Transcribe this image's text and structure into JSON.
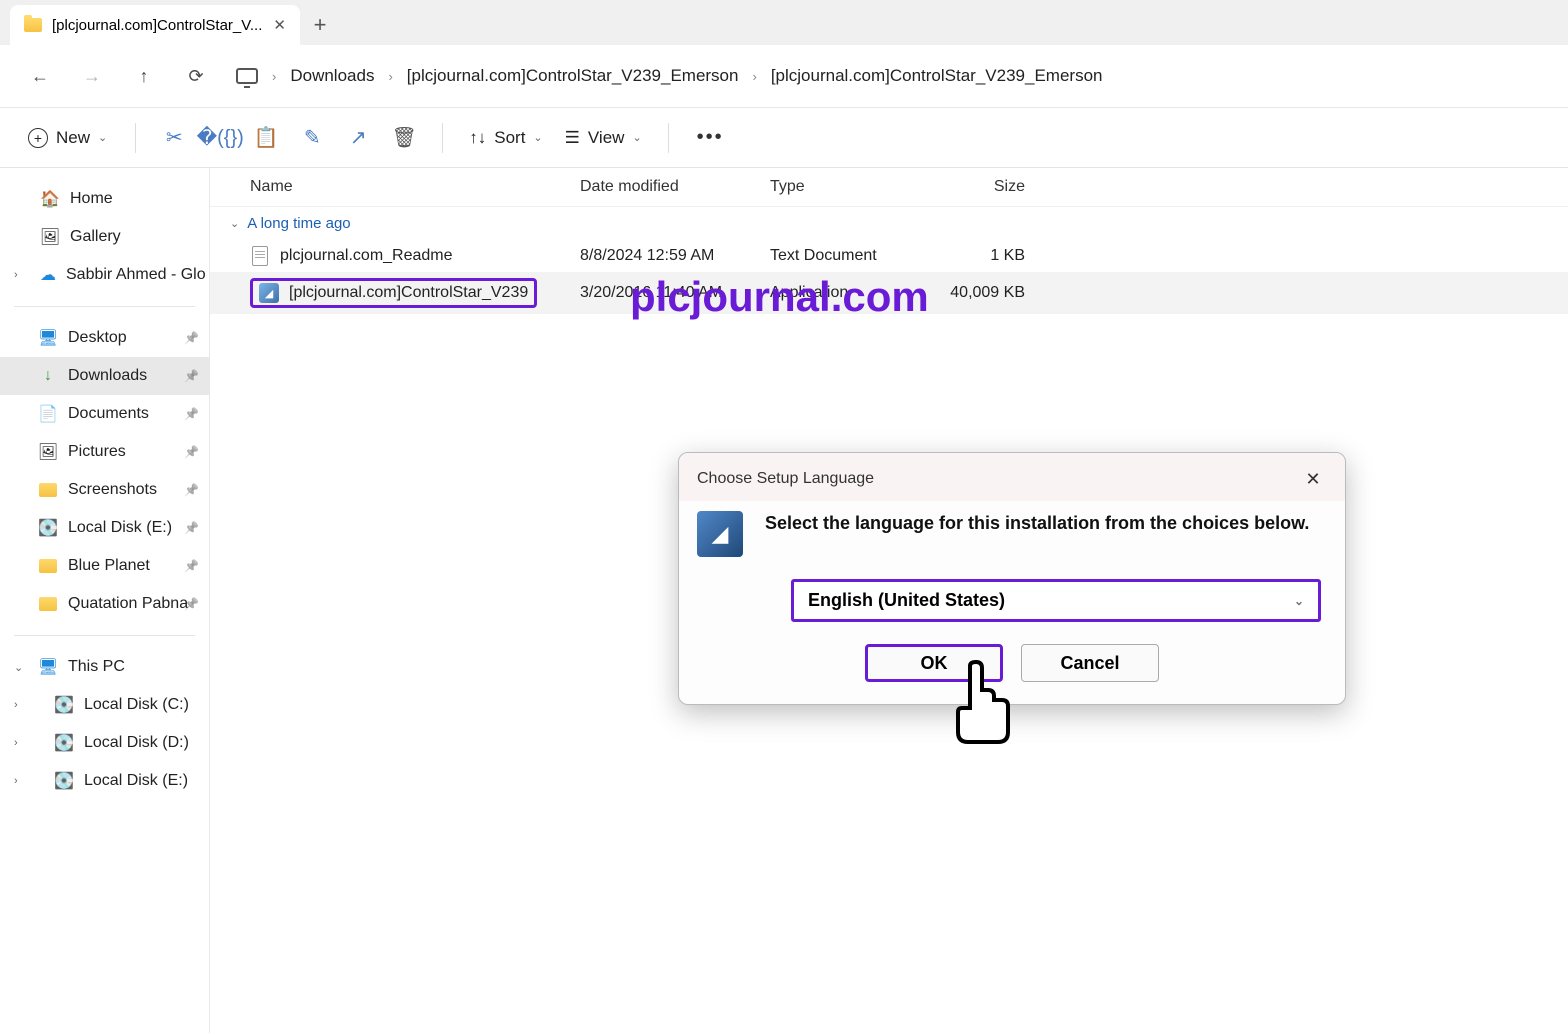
{
  "tab": {
    "title": "[plcjournal.com]ControlStar_V..."
  },
  "breadcrumb": {
    "items": [
      "Downloads",
      "[plcjournal.com]ControlStar_V239_Emerson",
      "[plcjournal.com]ControlStar_V239_Emerson"
    ]
  },
  "toolbar": {
    "new_label": "New",
    "sort_label": "Sort",
    "view_label": "View"
  },
  "sidebar": {
    "top": [
      {
        "label": "Home",
        "icon": "home"
      },
      {
        "label": "Gallery",
        "icon": "gallery"
      },
      {
        "label": "Sabbir Ahmed - Glo",
        "icon": "onedrive",
        "expandable": true
      }
    ],
    "pinned": [
      {
        "label": "Desktop",
        "icon": "desktop"
      },
      {
        "label": "Downloads",
        "icon": "downloads",
        "active": true
      },
      {
        "label": "Documents",
        "icon": "documents"
      },
      {
        "label": "Pictures",
        "icon": "pictures"
      },
      {
        "label": "Screenshots",
        "icon": "folder"
      },
      {
        "label": "Local Disk (E:)",
        "icon": "disk"
      },
      {
        "label": "Blue Planet",
        "icon": "folder"
      },
      {
        "label": "Quatation Pabna",
        "icon": "folder"
      }
    ],
    "thispc": {
      "label": "This PC",
      "drives": [
        "Local Disk (C:)",
        "Local Disk (D:)",
        "Local Disk (E:)"
      ]
    }
  },
  "columns": {
    "name": "Name",
    "date": "Date modified",
    "type": "Type",
    "size": "Size"
  },
  "group_label": "A long time ago",
  "files": [
    {
      "name": "plcjournal.com_Readme",
      "date": "8/8/2024 12:59 AM",
      "type": "Text Document",
      "size": "1 KB",
      "icon": "txt"
    },
    {
      "name": "[plcjournal.com]ControlStar_V239",
      "date": "3/20/2016 11:40 AM",
      "type": "Application",
      "size": "40,009 KB",
      "icon": "exe",
      "highlighted": true
    }
  ],
  "watermark": "plcjournal.com",
  "dialog": {
    "title": "Choose Setup Language",
    "message": "Select the language for this installation from the choices below.",
    "selected_language": "English (United States)",
    "ok_label": "OK",
    "cancel_label": "Cancel"
  }
}
